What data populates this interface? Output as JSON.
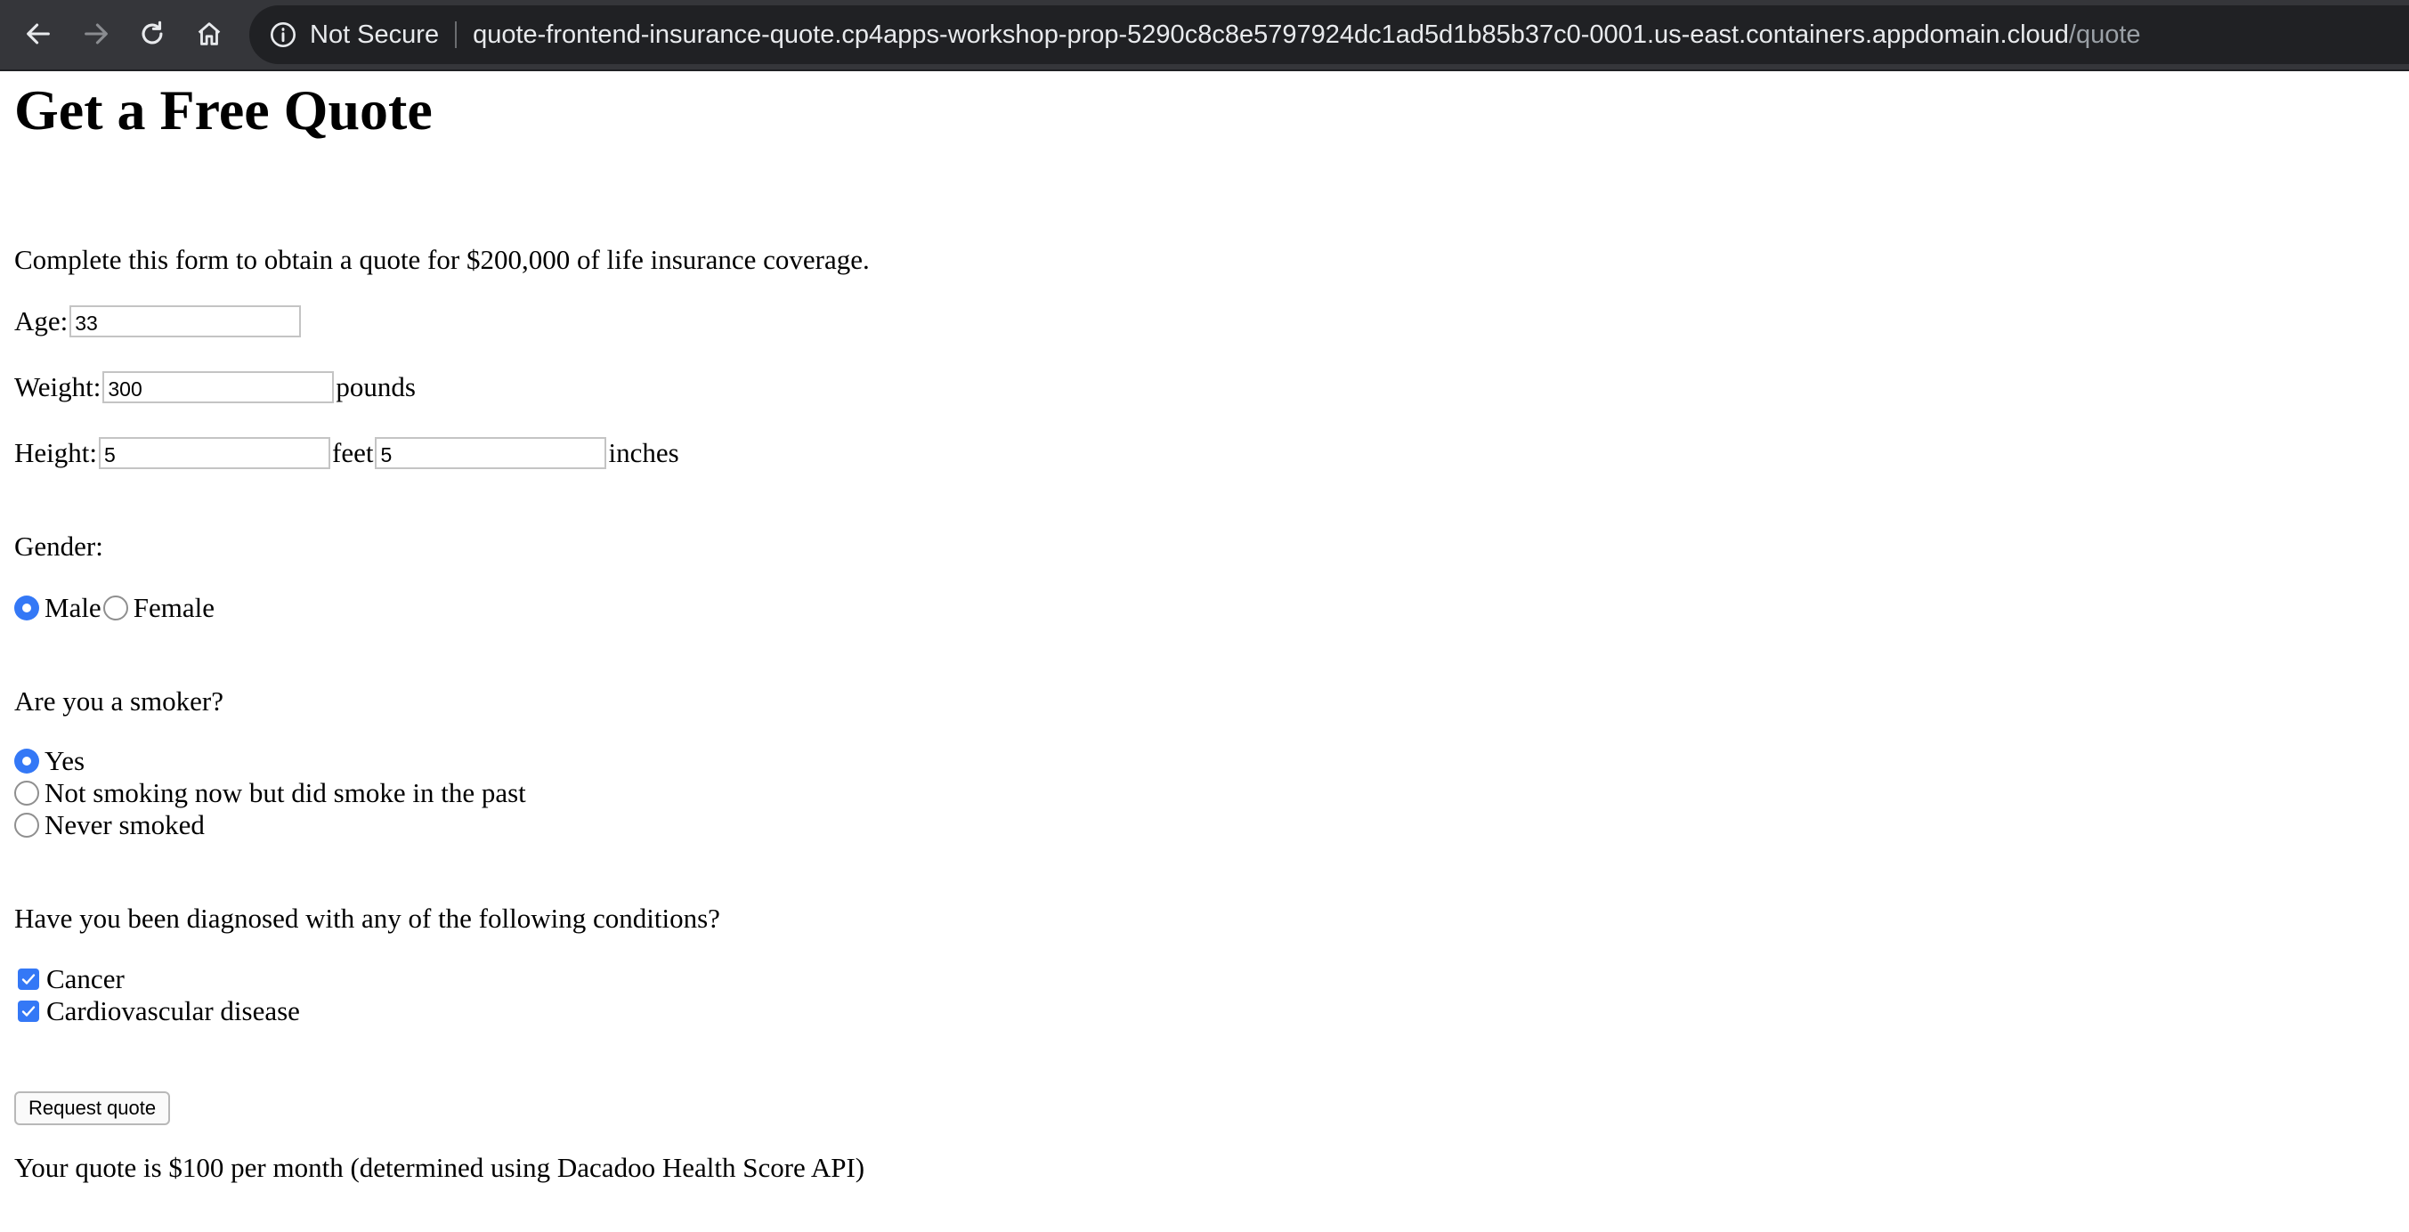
{
  "browser": {
    "security_label": "Not Secure",
    "url_host": "quote-frontend-insurance-quote.cp4apps-workshop-prop-5290c8c8e5797924dc1ad5d1b85b37c0-0001.us-east.containers.appdomain.cloud",
    "url_path": "/quote",
    "icons": [
      "back-arrow-icon",
      "forward-arrow-icon",
      "reload-icon",
      "home-icon",
      "info-icon"
    ]
  },
  "page": {
    "title": "Get a Free Quote",
    "intro": "Complete this form to obtain a quote for $200,000 of life insurance coverage."
  },
  "form": {
    "age_label": "Age:",
    "age_value": "33",
    "weight_label": "Weight:",
    "weight_value": "300",
    "weight_unit": "pounds",
    "height_label": "Height:",
    "height_feet_value": "5",
    "height_feet_unit": "feet",
    "height_inches_value": "5",
    "height_inches_unit": "inches",
    "gender_question": "Gender:",
    "gender_options": [
      {
        "label": "Male",
        "checked": true
      },
      {
        "label": "Female",
        "checked": false
      }
    ],
    "smoker_question": "Are you a smoker?",
    "smoker_options": [
      {
        "label": "Yes",
        "checked": true
      },
      {
        "label": "Not smoking now but did smoke in the past",
        "checked": false
      },
      {
        "label": "Never smoked",
        "checked": false
      }
    ],
    "conditions_question": "Have you been diagnosed with any of the following conditions?",
    "conditions": [
      {
        "label": "Cancer",
        "checked": true
      },
      {
        "label": "Cardiovascular disease",
        "checked": true
      }
    ],
    "submit_label": "Request quote"
  },
  "result": "Your quote is $100 per month (determined using Dacadoo Health Score API)",
  "colors": {
    "accent": "#3478f6",
    "toolbar": "#35363a",
    "omnibox": "#202124"
  }
}
